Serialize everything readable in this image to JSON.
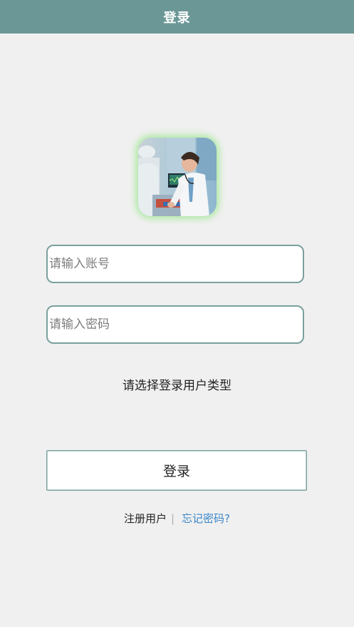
{
  "header": {
    "title": "登录"
  },
  "form": {
    "account_placeholder": "请输入账号",
    "password_placeholder": "请输入密码",
    "usertype_label": "请选择登录用户类型",
    "login_label": "登录"
  },
  "links": {
    "register": "注册用户",
    "separator": "|",
    "forgot": "忘记密码?"
  },
  "colors": {
    "header_bg": "#6b9896",
    "field_border": "#7aa09e",
    "avatar_glow": "#a6e89a",
    "link_blue": "#3a86c8"
  },
  "icons": {
    "avatar": "doctor-photo"
  }
}
